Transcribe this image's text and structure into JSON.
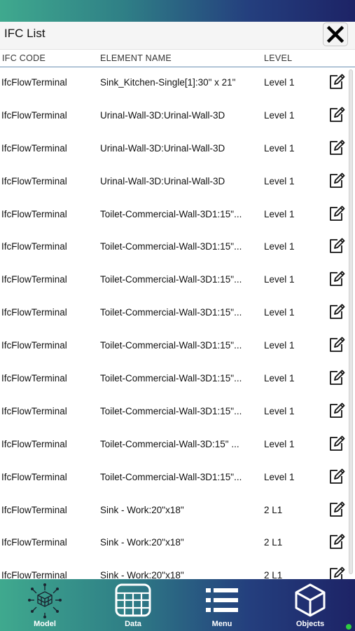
{
  "header": {
    "title": "IFC List",
    "close_label": "close"
  },
  "columns": {
    "code": "IFC CODE",
    "name": "ELEMENT NAME",
    "level": "LEVEL"
  },
  "rows": [
    {
      "code": "IfcFlowTerminal",
      "name": "Sink_Kitchen-Single[1]:30\" x 21\"",
      "level": "Level 1"
    },
    {
      "code": "IfcFlowTerminal",
      "name": "Urinal-Wall-3D:Urinal-Wall-3D",
      "level": "Level 1"
    },
    {
      "code": "IfcFlowTerminal",
      "name": "Urinal-Wall-3D:Urinal-Wall-3D",
      "level": "Level 1"
    },
    {
      "code": "IfcFlowTerminal",
      "name": "Urinal-Wall-3D:Urinal-Wall-3D",
      "level": "Level 1"
    },
    {
      "code": "IfcFlowTerminal",
      "name": "Toilet-Commercial-Wall-3D1:15\"...",
      "level": "Level 1"
    },
    {
      "code": "IfcFlowTerminal",
      "name": "Toilet-Commercial-Wall-3D1:15\"...",
      "level": "Level 1"
    },
    {
      "code": "IfcFlowTerminal",
      "name": "Toilet-Commercial-Wall-3D1:15\"...",
      "level": "Level 1"
    },
    {
      "code": "IfcFlowTerminal",
      "name": "Toilet-Commercial-Wall-3D1:15\"...",
      "level": "Level 1"
    },
    {
      "code": "IfcFlowTerminal",
      "name": "Toilet-Commercial-Wall-3D1:15\"...",
      "level": "Level 1"
    },
    {
      "code": "IfcFlowTerminal",
      "name": "Toilet-Commercial-Wall-3D1:15\"...",
      "level": "Level 1"
    },
    {
      "code": "IfcFlowTerminal",
      "name": "Toilet-Commercial-Wall-3D1:15\"...",
      "level": "Level 1"
    },
    {
      "code": "IfcFlowTerminal",
      "name": "Toilet-Commercial-Wall-3D:15\" ...",
      "level": "Level 1"
    },
    {
      "code": "IfcFlowTerminal",
      "name": "Toilet-Commercial-Wall-3D1:15\"...",
      "level": "Level 1"
    },
    {
      "code": "IfcFlowTerminal",
      "name": "Sink - Work:20\"x18\"",
      "level": "2 L1"
    },
    {
      "code": "IfcFlowTerminal",
      "name": "Sink - Work:20\"x18\"",
      "level": "2 L1"
    },
    {
      "code": "IfcFlowTerminal",
      "name": "Sink - Work:20\"x18\"",
      "level": "2 L1"
    }
  ],
  "nav": {
    "model": {
      "label": "Model",
      "icon": "cubes-network-icon"
    },
    "data": {
      "label": "Data",
      "icon": "grid-table-icon"
    },
    "menu": {
      "label": "Menu",
      "icon": "list-icon"
    },
    "objects": {
      "label": "Objects",
      "icon": "cube-icon"
    }
  },
  "colors": {
    "gradient_start": "#3fa98e",
    "gradient_end": "#1d2366",
    "status_dot": "#2ecc40"
  }
}
